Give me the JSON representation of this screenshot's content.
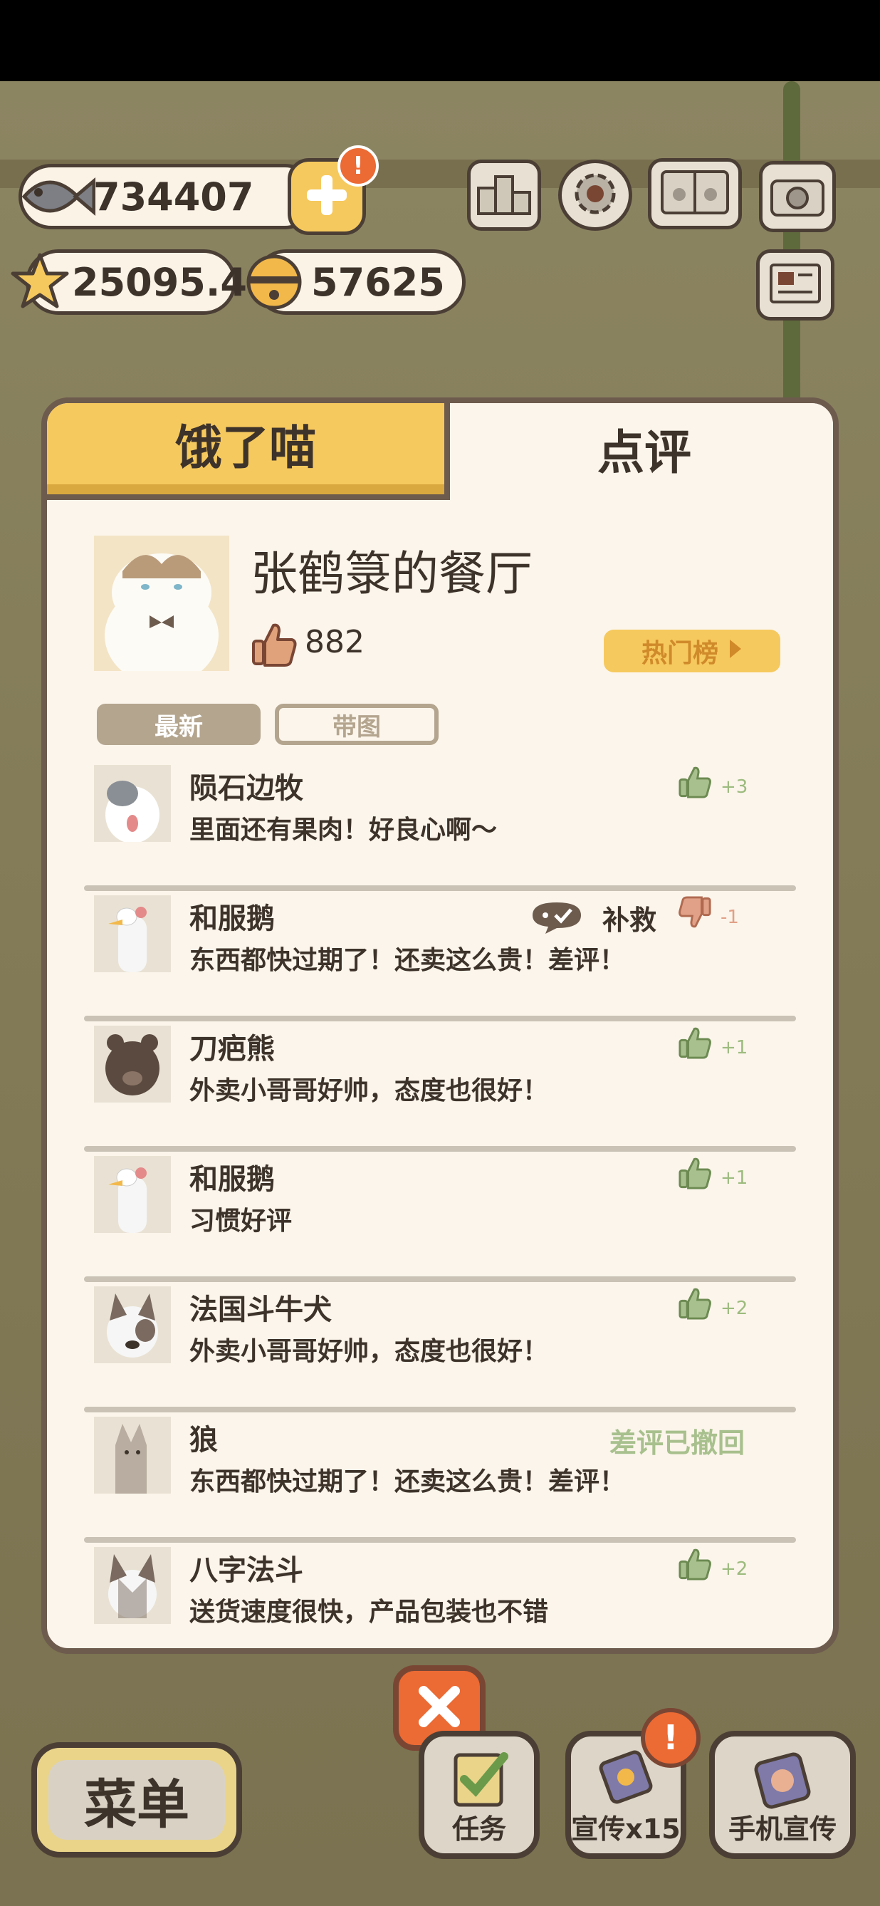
{
  "hud": {
    "fish": "734407",
    "stars": "25095.4",
    "bells": "57625"
  },
  "panel": {
    "tabs": [
      "饿了喵",
      "点评"
    ],
    "restaurant_name": "张鹤箓的餐厅",
    "like_count": "882",
    "hot_list_label": "热门榜",
    "filters": [
      "最新",
      "带图"
    ]
  },
  "reviews": [
    {
      "name": "陨石边牧",
      "text": "里面还有果肉！好良心啊～",
      "score": "+3",
      "status": "positive"
    },
    {
      "name": "和服鹅",
      "text": "东西都快过期了！还卖这么贵！差评！",
      "score": "-1",
      "status": "negative",
      "remedy_label": "补救"
    },
    {
      "name": "刀疤熊",
      "text": "外卖小哥哥好帅，态度也很好！",
      "score": "+1",
      "status": "positive"
    },
    {
      "name": "和服鹅",
      "text": "习惯好评",
      "score": "+1",
      "status": "positive"
    },
    {
      "name": "法国斗牛犬",
      "text": "外卖小哥哥好帅，态度也很好！",
      "score": "+2",
      "status": "positive"
    },
    {
      "name": "狼",
      "text": "东西都快过期了！还卖这么贵！差评！",
      "status": "retracted",
      "retracted_label": "差评已撤回"
    },
    {
      "name": "八字法斗",
      "text": "送货速度很快，产品包装也不错",
      "score": "+2",
      "status": "positive"
    }
  ],
  "bottom_bar": {
    "menu_label": "菜单",
    "task_label": "任务",
    "promo_label": "宣传x15",
    "phone_promo_label": "手机宣传"
  },
  "icons": {
    "fish": "fish-icon",
    "star": "star-icon",
    "bell": "bell-icon",
    "add": "plus-icon",
    "ranking": "ranking-podium-icon",
    "settings": "gear-icon",
    "book": "paw-book-icon",
    "camera": "camera-icon",
    "newspaper": "newspaper-icon",
    "thumb_up": "thumb-up-icon",
    "thumb_down": "thumb-down-icon",
    "close": "close-icon"
  },
  "colors": {
    "accent_yellow": "#f6c95e",
    "positive_green": "#9dbb7e",
    "negative_orange": "#e1a188",
    "close_red": "#ec6a34"
  }
}
